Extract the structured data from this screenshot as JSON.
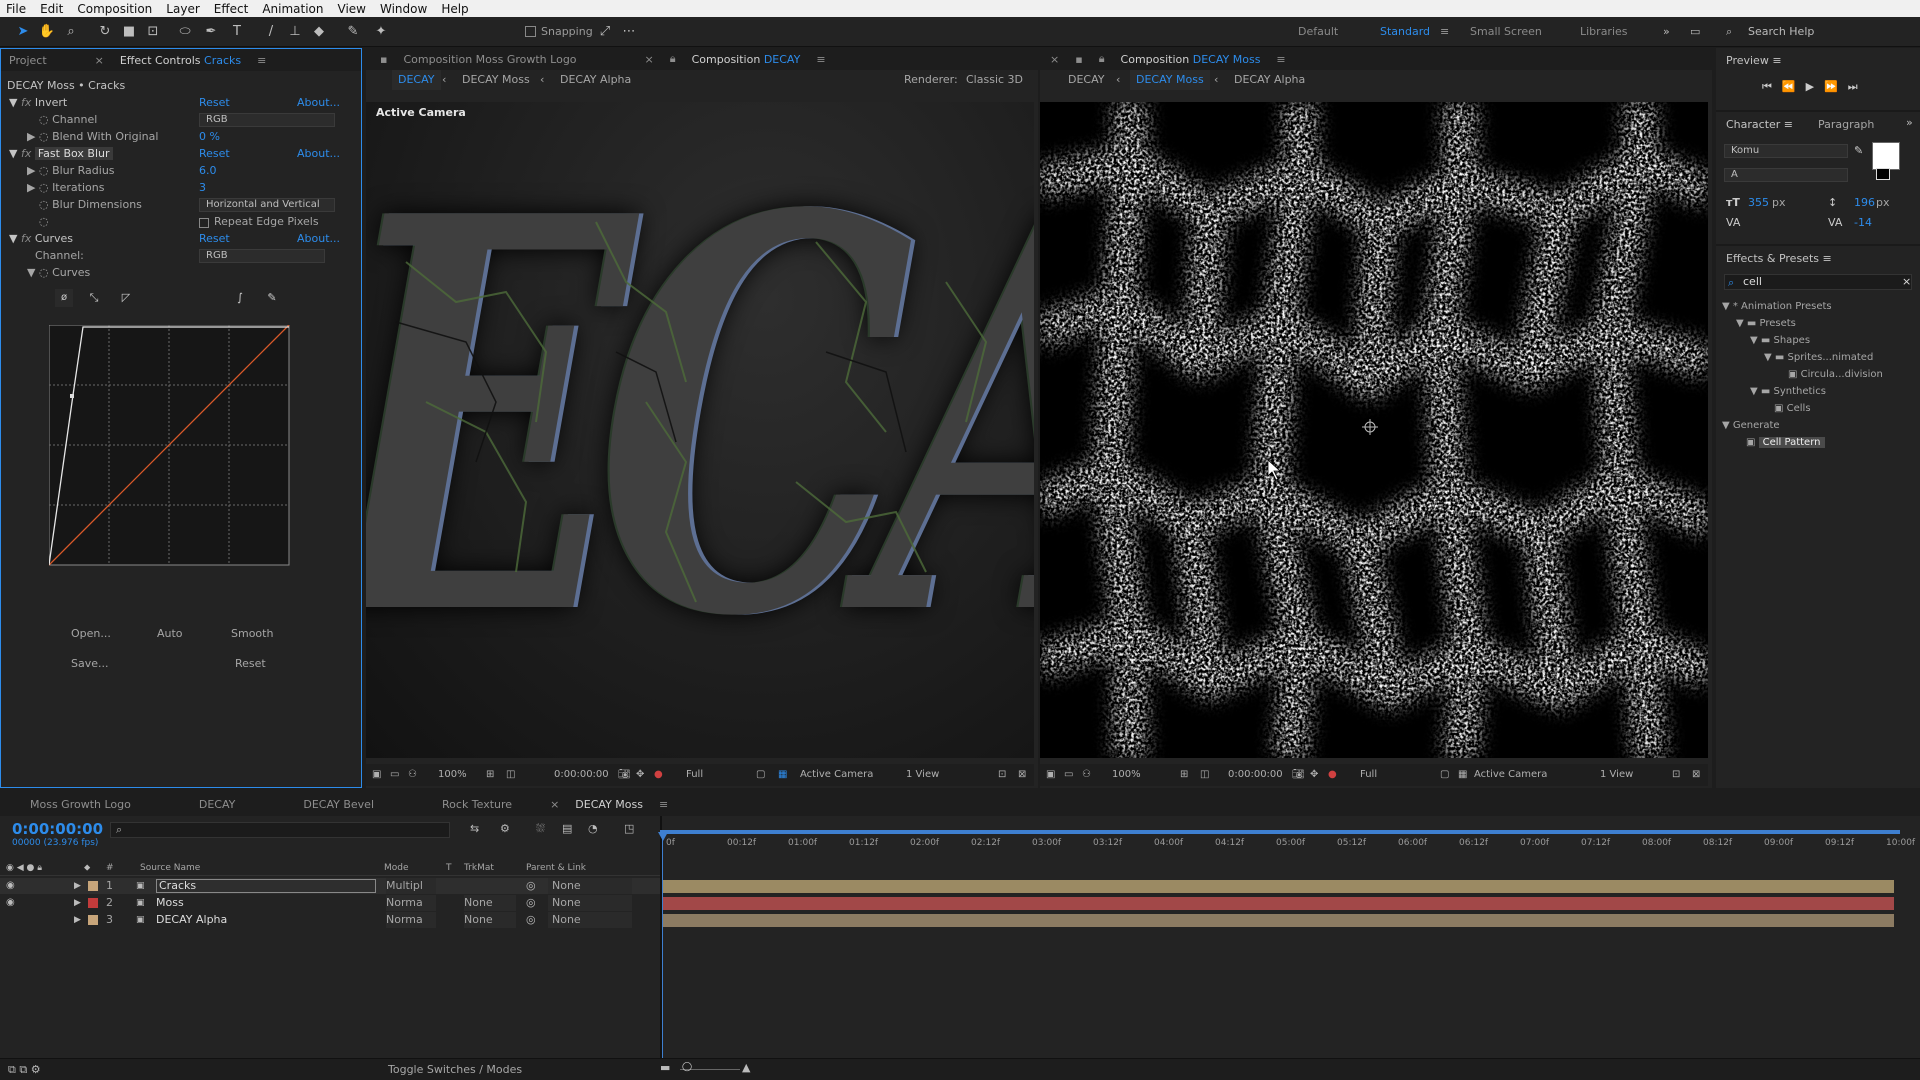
{
  "menu": [
    "File",
    "Edit",
    "Composition",
    "Layer",
    "Effect",
    "Animation",
    "View",
    "Window",
    "Help"
  ],
  "toolbar": {
    "snapping_label": "Snapping",
    "workspaces": [
      "Default",
      "Standard",
      "Small Screen",
      "Libraries"
    ],
    "active_workspace": "Standard",
    "search_help": "Search Help"
  },
  "effect_controls": {
    "project_tab": "Project",
    "tab_prefix": "Effect Controls",
    "tab_layer": "Cracks",
    "header": "DECAY Moss • Cracks",
    "reset": "Reset",
    "about": "About...",
    "invert": {
      "name": "Invert",
      "channel_label": "Channel",
      "channel_value": "RGB",
      "blend_label": "Blend With Original",
      "blend_value": "0 %"
    },
    "fast_box_blur": {
      "name": "Fast Box Blur",
      "radius_label": "Blur Radius",
      "radius_value": "6.0",
      "iterations_label": "Iterations",
      "iterations_value": "3",
      "dimensions_label": "Blur Dimensions",
      "dimensions_value": "Horizontal and Vertical",
      "repeat_edge": "Repeat Edge Pixels"
    },
    "curves": {
      "name": "Curves",
      "channel_label": "Channel:",
      "channel_value": "RGB",
      "sub_label": "Curves",
      "open": "Open...",
      "auto": "Auto",
      "smooth": "Smooth",
      "save": "Save...",
      "reset": "Reset"
    }
  },
  "comp_left": {
    "tab_moss_logo": "Composition Moss Growth Logo",
    "tab_prefix": "Composition",
    "tab_name": "DECAY",
    "crumbs": [
      "DECAY",
      "DECAY Moss",
      "DECAY Alpha"
    ],
    "renderer_label": "Renderer:",
    "renderer_value": "Classic 3D",
    "camera_label": "Active Camera",
    "decay_text": "ECA",
    "zoom": "100%",
    "time": "0:00:00:00",
    "quality": "Full",
    "camera": "Active Camera",
    "views": "1 View"
  },
  "comp_right": {
    "tab_prefix": "Composition",
    "tab_name": "DECAY Moss",
    "crumbs": [
      "DECAY",
      "DECAY Moss",
      "DECAY Alpha"
    ],
    "zoom": "100%",
    "time": "0:00:00:00",
    "quality": "Full",
    "camera": "Active Camera",
    "views": "1 View"
  },
  "preview": {
    "title": "Preview"
  },
  "character": {
    "tab": "Character",
    "tab2": "Paragraph",
    "font": "Komu",
    "style": "A",
    "size": "355",
    "size_unit": "px",
    "leading": "196",
    "leading_unit": "px",
    "tracking": "-14"
  },
  "effects_presets": {
    "title": "Effects & Presets",
    "search": "cell",
    "tree": [
      "* Animation Presets",
      "Presets",
      "Shapes",
      "Sprites...nimated",
      "Circula...division",
      "Synthetics",
      "Cells",
      "Generate",
      "Cell Pattern"
    ]
  },
  "timeline": {
    "tabs": [
      "Moss Growth Logo",
      "DECAY",
      "DECAY Bevel",
      "Rock Texture",
      "DECAY Moss"
    ],
    "active_tab": "DECAY Moss",
    "timecode": "0:00:00:00",
    "frames": "00000 (23.976 fps)",
    "columns": {
      "source": "Source Name",
      "mode": "Mode",
      "t": "T",
      "trkmat": "TrkMat",
      "parent": "Parent & Link"
    },
    "ruler": [
      "0f",
      "00:12f",
      "01:00f",
      "01:12f",
      "02:00f",
      "02:12f",
      "03:00f",
      "03:12f",
      "04:00f",
      "04:12f",
      "05:00f",
      "05:12f",
      "06:00f",
      "06:12f",
      "07:00f",
      "07:12f",
      "08:00f",
      "08:12f",
      "09:00f",
      "09:12f",
      "10:00f"
    ],
    "layers": [
      {
        "num": "1",
        "name": "Cracks",
        "mode": "Multipl",
        "trkmat": "",
        "parent": "None",
        "label_color": "#c7a57a",
        "bar_color": "#9b8a63"
      },
      {
        "num": "2",
        "name": "Moss",
        "mode": "Norma",
        "trkmat": "None",
        "parent": "None",
        "label_color": "#c23b3b",
        "bar_color": "#a24848"
      },
      {
        "num": "3",
        "name": "DECAY Alpha",
        "mode": "Norma",
        "trkmat": "None",
        "parent": "None",
        "label_color": "#c7a57a",
        "bar_color": "#8c7b62"
      }
    ],
    "toggle": "Toggle Switches / Modes"
  }
}
